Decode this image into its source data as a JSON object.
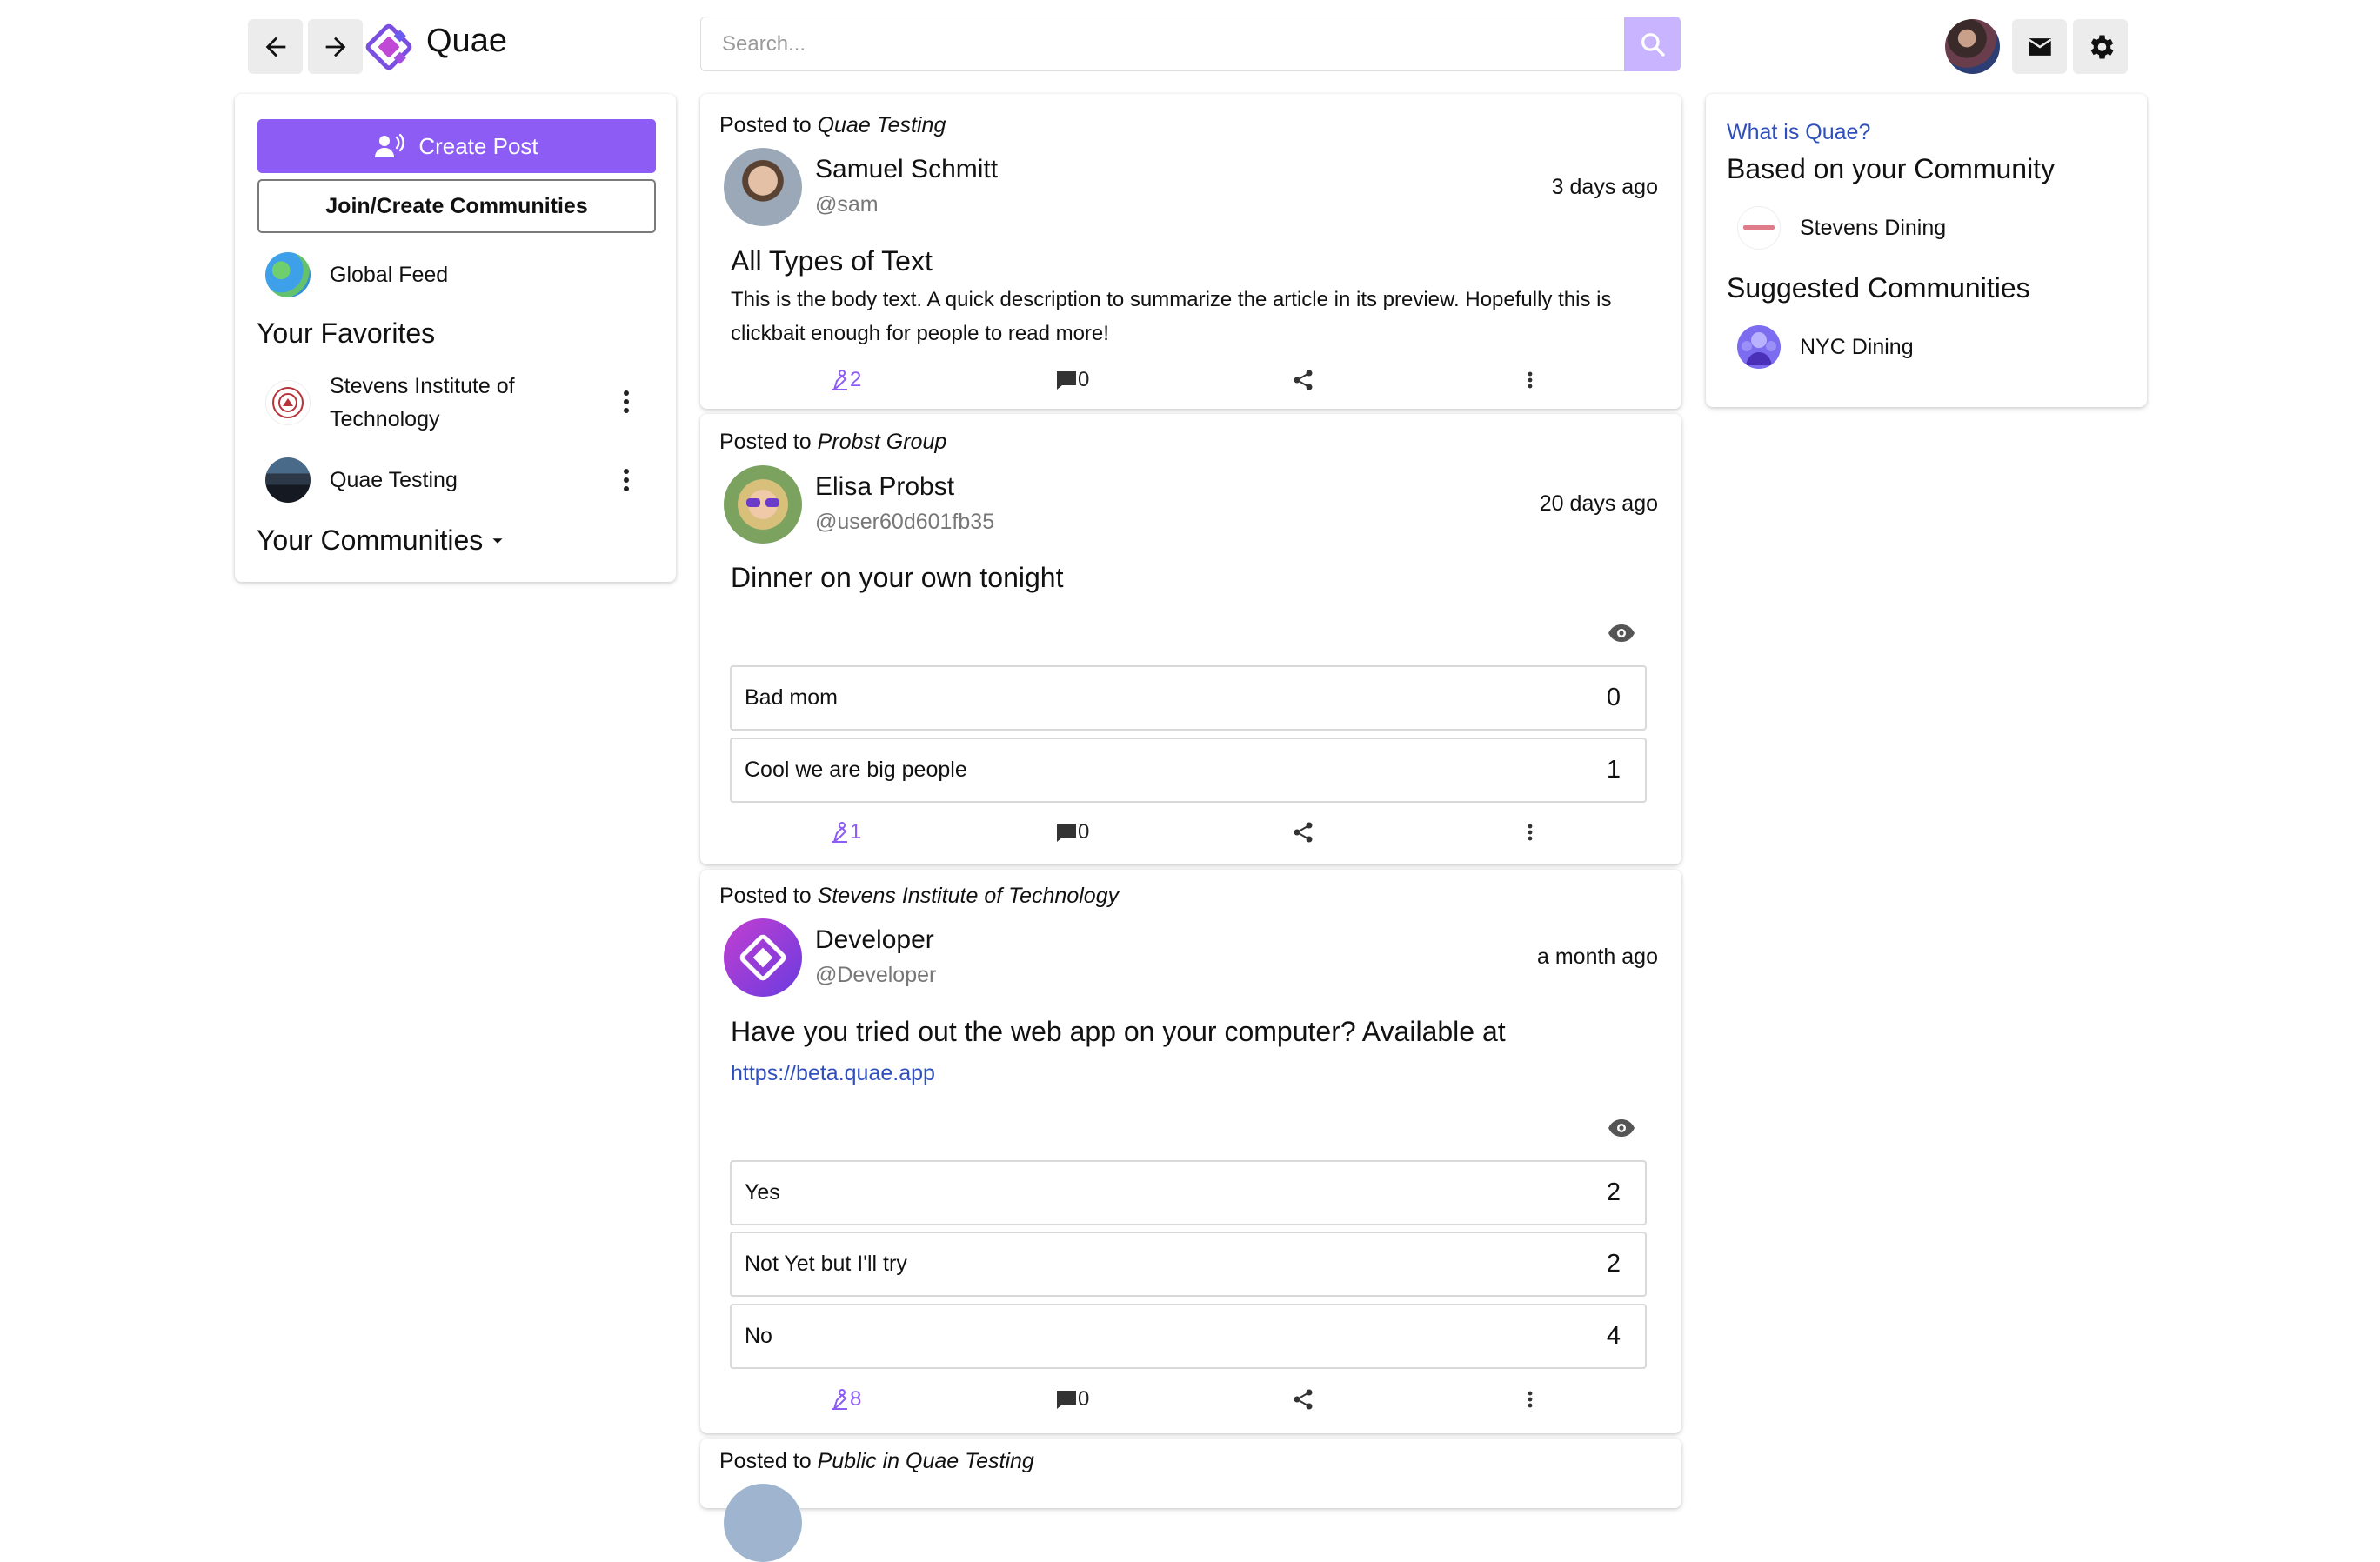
{
  "header": {
    "brand": "Quae",
    "search_placeholder": "Search..."
  },
  "sidebar": {
    "create_post": "Create Post",
    "join_create": "Join/Create Communities",
    "global_feed": "Global Feed",
    "favorites_title": "Your Favorites",
    "favorites": [
      {
        "label_line1": "Stevens Institute of",
        "label_line2": "Technology"
      },
      {
        "label": "Quae Testing"
      }
    ],
    "communities_title": "Your Communities"
  },
  "right_panel": {
    "what_is": "What is Quae?",
    "based_title": "Based on your Community",
    "based_items": [
      "Stevens Dining"
    ],
    "suggested_title": "Suggested Communities",
    "suggested_items": [
      "NYC Dining"
    ]
  },
  "posts": [
    {
      "posted_prefix": "Posted to ",
      "community": "Quae Testing",
      "author": "Samuel Schmitt",
      "handle": "@sam",
      "time": "3 days ago",
      "title": "All Types of Text",
      "body": "This is the body text. A quick description to summarize the article in its preview. Hopefully this is clickbait enough for people to read more!",
      "likes": "2",
      "comments": "0"
    },
    {
      "posted_prefix": "Posted to ",
      "community": "Probst Group",
      "author": "Elisa Probst",
      "handle": "@user60d601fb35",
      "time": "20 days ago",
      "title": "Dinner on your own tonight",
      "poll": [
        {
          "label": "Bad mom",
          "count": "0"
        },
        {
          "label": "Cool we are big people",
          "count": "1"
        }
      ],
      "likes": "1",
      "comments": "0"
    },
    {
      "posted_prefix": "Posted to ",
      "community": "Stevens Institute of Technology",
      "author": "Developer",
      "handle": "@Developer",
      "time": "a month ago",
      "title": "Have you tried out the web app on your computer? Available at",
      "link": "https://beta.quae.app",
      "poll": [
        {
          "label": "Yes",
          "count": "2"
        },
        {
          "label": "Not Yet but I'll try",
          "count": "2"
        },
        {
          "label": "No",
          "count": "4"
        }
      ],
      "likes": "8",
      "comments": "0"
    },
    {
      "posted_prefix": "Posted to ",
      "community": "Public in Quae Testing"
    }
  ],
  "colors": {
    "accent": "#8c5cf5",
    "link": "#2f4fbf",
    "like": "#8c5cf5"
  }
}
